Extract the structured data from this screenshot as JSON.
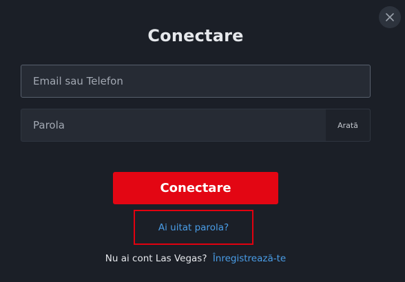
{
  "dialog": {
    "title": "Conectare",
    "close_icon": "close-icon"
  },
  "form": {
    "email_placeholder": "Email sau Telefon",
    "email_value": "",
    "password_placeholder": "Parola",
    "password_value": "",
    "show_password_label": "Arată",
    "submit_label": "Conectare",
    "forgot_password_label": "Ai uitat parola?"
  },
  "footer": {
    "prompt": "Nu ai cont Las Vegas?",
    "signup_label": "Înregistrează-te"
  },
  "colors": {
    "background": "#1b1f27",
    "accent_red": "#e30613",
    "link_blue": "#4a9ee8",
    "highlight_box": "#e3000f"
  }
}
